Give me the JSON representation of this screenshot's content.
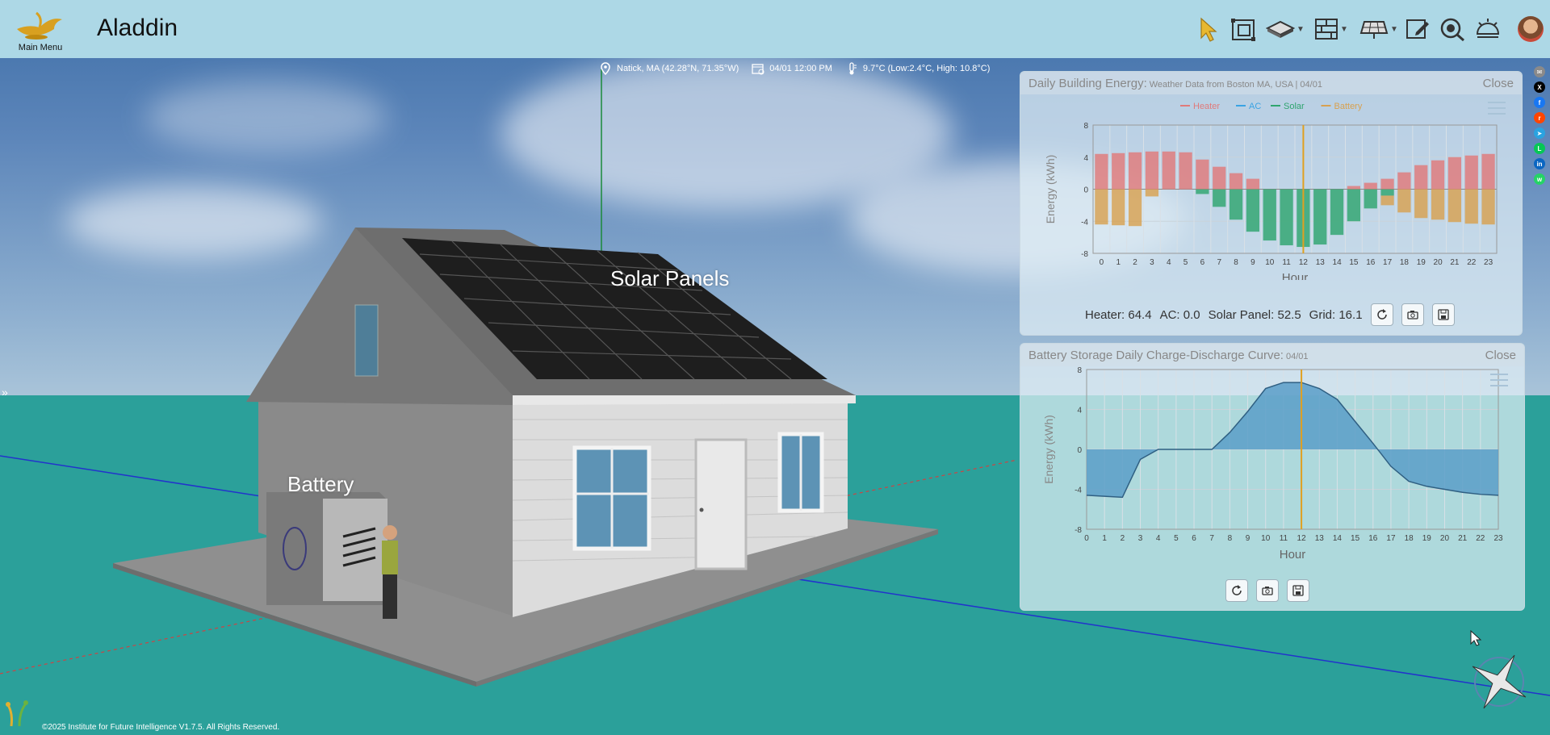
{
  "header": {
    "app_title": "Aladdin",
    "main_menu_label": "Main Menu"
  },
  "toolbar": {
    "icons": [
      "select-icon",
      "resize-icon",
      "foundation-icon",
      "wall-icon",
      "solar-panel-icon",
      "edit-note-icon",
      "view-icon",
      "weather-icon"
    ]
  },
  "weather_bar": {
    "location": "Natick, MA (42.28°N, 71.35°W)",
    "datetime": "04/01 12:00 PM",
    "temperature": "9.7°C (Low:2.4°C, High: 10.8°C)"
  },
  "scene_labels": {
    "solar_panels": "Solar Panels",
    "battery": "Battery"
  },
  "energy_panel": {
    "title": "Daily Building Energy:",
    "subtitle": "Weather Data from Boston MA, USA | 04/01",
    "close_label": "Close",
    "summary": {
      "heater": "Heater: 64.4",
      "ac": "AC: 0.0",
      "solar": "Solar Panel: 52.5",
      "grid": "Grid: 16.1"
    }
  },
  "battery_panel": {
    "title": "Battery Storage Daily Charge-Discharge Curve:",
    "subtitle": "04/01",
    "close_label": "Close"
  },
  "footer": {
    "copyright": "©2025 Institute for Future Intelligence V1.7.5. All Rights Reserved."
  },
  "colors": {
    "heater": "#e07a7a",
    "ac": "#3aa3e3",
    "solar": "#2fa56f",
    "battery": "#d8a150",
    "battery_area": "#5b9ec8",
    "cursor_line": "#e0a020"
  },
  "chart_data": [
    {
      "type": "bar",
      "categories": [
        "0",
        "1",
        "2",
        "3",
        "4",
        "5",
        "6",
        "7",
        "8",
        "9",
        "10",
        "11",
        "12",
        "13",
        "14",
        "15",
        "16",
        "17",
        "18",
        "19",
        "20",
        "21",
        "22",
        "23"
      ],
      "xlabel": "Hour",
      "ylabel": "Energy (kWh)",
      "ylim": [
        -8,
        8
      ],
      "yticks": [
        -8,
        -4,
        0,
        4,
        8
      ],
      "legend_position": "top",
      "highlight_x": 12,
      "series": [
        {
          "name": "Heater",
          "values": [
            4.4,
            4.5,
            4.6,
            4.7,
            4.7,
            4.6,
            3.7,
            2.8,
            2.0,
            1.3,
            0,
            0,
            0,
            0,
            0,
            0.4,
            0.8,
            1.3,
            2.1,
            3.0,
            3.6,
            4.0,
            4.2,
            4.4
          ]
        },
        {
          "name": "AC",
          "values": [
            0,
            0,
            0,
            0,
            0,
            0,
            0,
            0,
            0,
            0,
            0,
            0,
            0,
            0,
            0,
            0,
            0,
            0,
            0,
            0,
            0,
            0,
            0,
            0
          ]
        },
        {
          "name": "Solar",
          "values": [
            0,
            0,
            0,
            0,
            0,
            0,
            -0.6,
            -2.2,
            -3.8,
            -5.3,
            -6.4,
            -7.0,
            -7.2,
            -6.9,
            -5.7,
            -4.0,
            -2.4,
            -0.8,
            0,
            0,
            0,
            0,
            0,
            0
          ]
        },
        {
          "name": "Battery",
          "values": [
            -4.4,
            -4.5,
            -4.6,
            -0.9,
            0,
            0,
            0,
            0,
            0,
            0,
            0,
            0,
            0,
            0,
            0,
            0,
            0,
            -1.2,
            -2.9,
            -3.6,
            -3.8,
            -4.1,
            -4.3,
            -4.4
          ]
        }
      ]
    },
    {
      "type": "area",
      "x": [
        0,
        1,
        2,
        3,
        4,
        5,
        6,
        7,
        8,
        9,
        10,
        11,
        12,
        13,
        14,
        15,
        16,
        17,
        18,
        19,
        20,
        21,
        22,
        23
      ],
      "values": [
        -4.6,
        -4.7,
        -4.8,
        -1.0,
        0,
        0,
        0,
        0,
        1.7,
        3.8,
        6.1,
        6.7,
        6.7,
        6.1,
        5.0,
        2.8,
        0.6,
        -1.7,
        -3.2,
        -3.7,
        -4.0,
        -4.3,
        -4.5,
        -4.6
      ],
      "xlabel": "Hour",
      "ylabel": "Energy (kWh)",
      "ylim": [
        -8,
        8
      ],
      "yticks": [
        -8,
        -4,
        0,
        4,
        8
      ],
      "highlight_x": 12
    }
  ]
}
